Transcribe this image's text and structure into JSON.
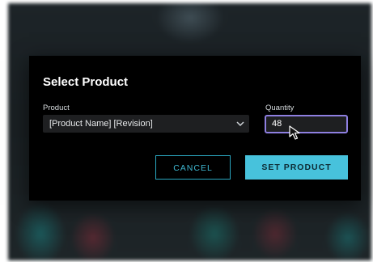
{
  "dialog": {
    "title": "Select Product",
    "product": {
      "label": "Product",
      "selected_value": "[Product Name] [Revision]",
      "dropdown_icon": "chevron-down-icon"
    },
    "quantity": {
      "label": "Quantity",
      "value": "48"
    },
    "buttons": {
      "cancel_label": "CANCEL",
      "confirm_label": "SET PRODUCT"
    }
  },
  "colors": {
    "accent": "#47c2dc",
    "focus_border": "#8e7fe0",
    "dialog_background": "#000000"
  },
  "icons": {
    "cursor": "mouse-pointer-icon"
  }
}
